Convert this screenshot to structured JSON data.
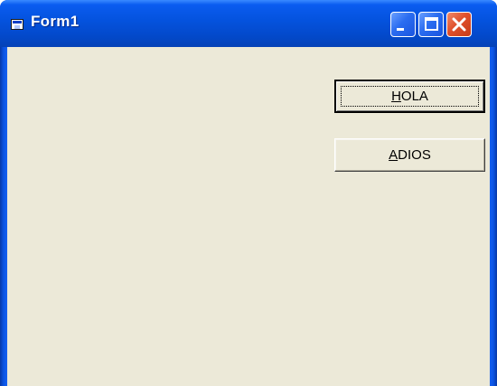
{
  "window": {
    "title": "Form1",
    "icon": "form-icon"
  },
  "caption_buttons": {
    "minimize_icon": "minimize-icon",
    "maximize_icon": "maximize-icon",
    "close_icon": "close-icon"
  },
  "buttons": [
    {
      "label_mnemonic": "H",
      "label_rest": "OLA",
      "is_default": true
    },
    {
      "label_mnemonic": "A",
      "label_rest": "DIOS",
      "is_default": false
    }
  ],
  "colors": {
    "titlebar": "#0452dd",
    "client": "#ece9d8",
    "close": "#e0502c"
  }
}
